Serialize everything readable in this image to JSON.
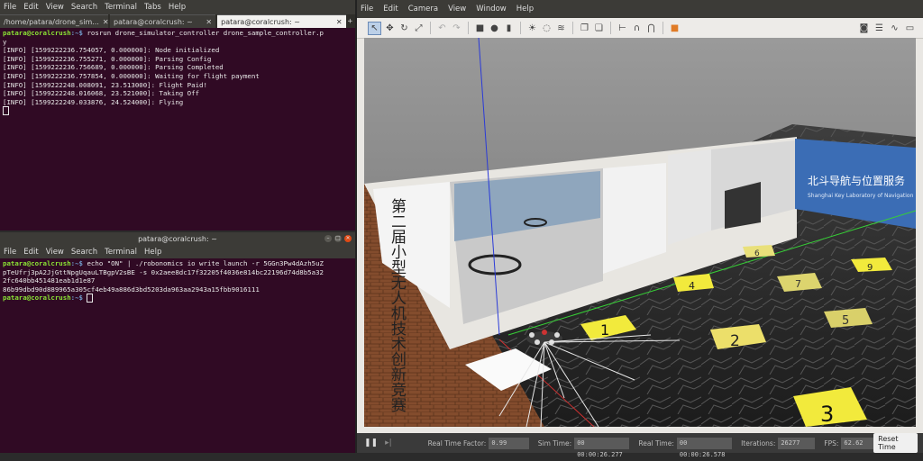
{
  "terminal1": {
    "menu": [
      "File",
      "Edit",
      "View",
      "Search",
      "Terminal",
      "Tabs",
      "Help"
    ],
    "tabs": [
      "/home/patara/drone_sim...",
      "patara@coralcrush: ~",
      "patara@coralcrush: ~"
    ],
    "lines": [
      "[INFO] [1599222236.754057, 0.000000]: Node initialized",
      "[INFO] [1599222236.755271, 0.000000]: Parsing Config",
      "[INFO] [1599222236.756689, 0.000000]: Parsing Completed",
      "[INFO] [1599222236.757854, 0.000000]: Waiting for flight payment",
      "[INFO] [1599222248.008091, 23.513000]: Flight Paid!",
      "[INFO] [1599222248.016068, 23.521000]: Taking Off",
      "[INFO] [1599222249.033876, 24.524000]: Flying"
    ],
    "prompt_user": "patara@coralcrush",
    "prompt_path": ":~$",
    "command": " rosrun drone_simulator_controller drone_sample_controller.p",
    "command_wrap": "y"
  },
  "terminal2": {
    "title": "patara@coralcrush: ~",
    "menu": [
      "File",
      "Edit",
      "View",
      "Search",
      "Terminal",
      "Help"
    ],
    "prompt_user": "patara@coralcrush",
    "prompt_path": ":~$",
    "command_lines": [
      " echo \"ON\" | ./robonomics io write launch -r 5GGn3Pw4dAzh5uZ",
      "pTeUfrj3pA2JjGttNpgUqauLTBgpV2sBE -s 0x2aee8dc17f32205f4036e814bc22196d74d8b5a32",
      "2fc640bb451481eab1d1e87",
      "86b99dbd90d889965a305cf4eb49a886d3bd5203da963aa2943a15fbb9016111"
    ]
  },
  "gazebo": {
    "menu": [
      "File",
      "Edit",
      "Camera",
      "View",
      "Window",
      "Help"
    ],
    "status": {
      "rtf_label": "Real Time Factor:",
      "rtf": "0.99",
      "sim_label": "Sim Time:",
      "sim": "00 00:00:26.277",
      "real_label": "Real Time:",
      "real": "00 00:00:26.578",
      "iter_label": "Iterations:",
      "iter": "26277",
      "fps_label": "FPS:",
      "fps": "62.62",
      "reset": "Reset Time"
    },
    "scene": {
      "banner_left": "第二届小型无人机技术创新竞赛",
      "banner_right": "北斗导航与位置服务",
      "banner_right_en": "Shanghai Key Laboratory of Navigation",
      "pad_numbers": [
        "1",
        "2",
        "3",
        "4",
        "5",
        "6",
        "7",
        "9"
      ]
    }
  },
  "colors": {
    "terminal_bg": "#300a24",
    "prompt_user": "#8ae234",
    "prompt_path": "#729fcf",
    "pad": "#f2ea3c"
  }
}
